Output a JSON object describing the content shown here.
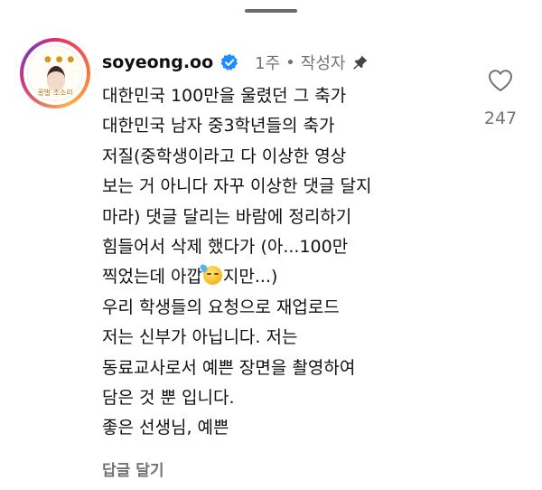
{
  "comment": {
    "username": "soyeong.oo",
    "time": "1주",
    "separator": "•",
    "author_tag": "작성자",
    "avatar_caption": "꿀벌 소소리",
    "lines": [
      "대한민국 100만을 울렸던 그 축가",
      "대한민국 남자 중3학년들의 축가",
      "저질(중학생이라고 다 이상한 영상",
      "보는 거 아니다 자꾸 이상한 댓글 달지",
      "마라) 댓글 달리는 바람에 정리하기",
      "힘들어서 삭제 했다가 (아...100만",
      "찍었는데 아깝",
      "지만...)",
      "우리 학생들의 요청으로 재업로드",
      "저는 신부가 아닙니다. 저는",
      "동료교사로서 예쁜 장면을 촬영하여",
      "담은 것 뿐 입니다.",
      "좋은 선생님, 예쁜"
    ],
    "reply_label": "답글 달기",
    "like_count": "247"
  },
  "icons": {
    "verified": "verified-badge-icon",
    "pin": "pin-icon",
    "like": "heart-outline-icon",
    "emoji": "downcast-sweat-emoji"
  },
  "colors": {
    "verified_blue": "#1a8cff",
    "muted_text": "#737373"
  }
}
